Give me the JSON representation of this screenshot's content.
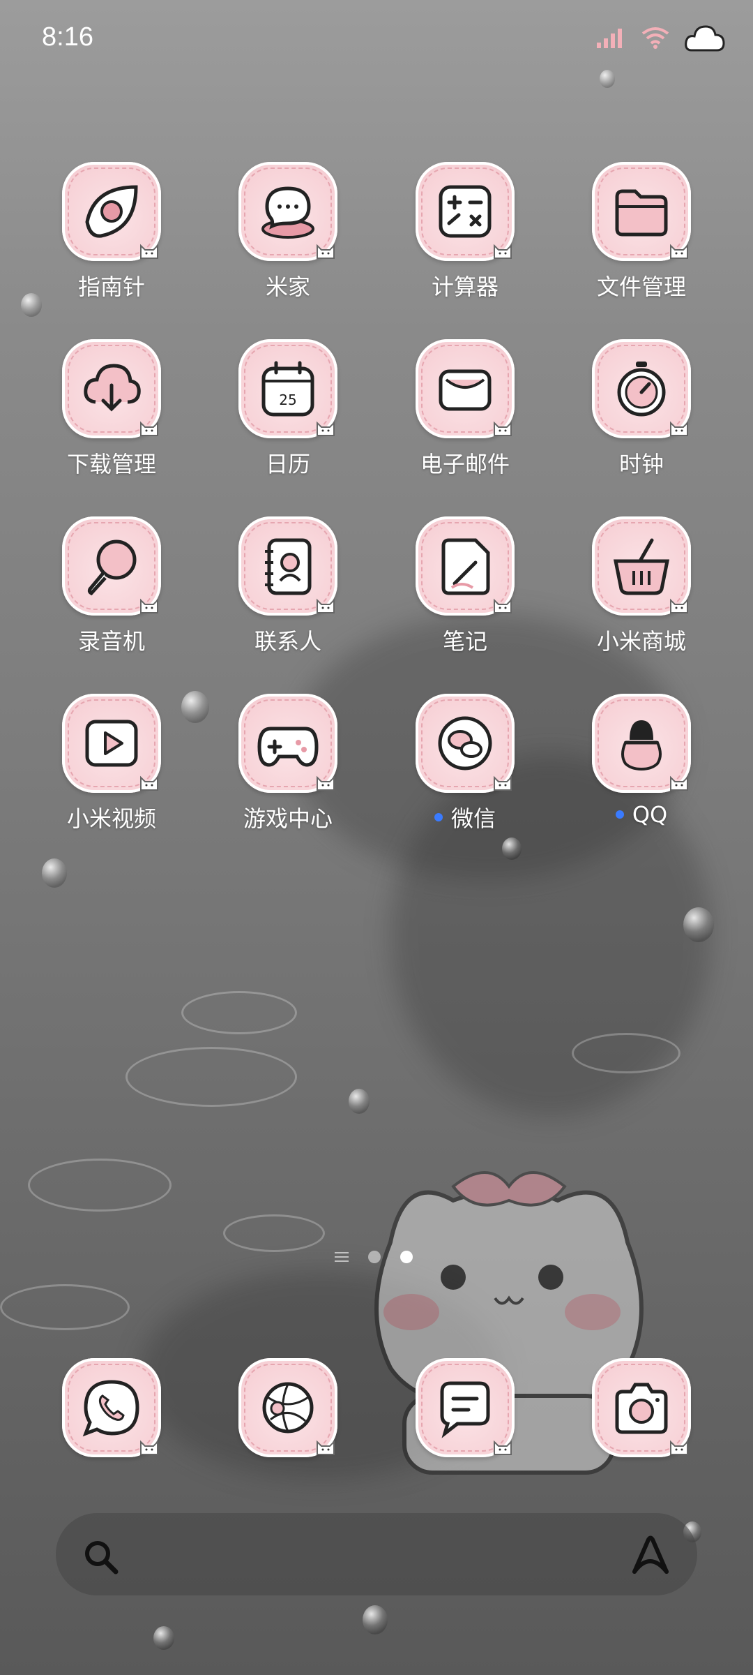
{
  "status_bar": {
    "time": "8:16"
  },
  "apps": [
    {
      "label": "指南针",
      "icon": "compass-icon"
    },
    {
      "label": "米家",
      "icon": "chat-bubble-icon"
    },
    {
      "label": "计算器",
      "icon": "calculator-icon"
    },
    {
      "label": "文件管理",
      "icon": "folder-icon"
    },
    {
      "label": "下载管理",
      "icon": "cloud-download-icon"
    },
    {
      "label": "日历",
      "icon": "calendar-icon",
      "date": "25"
    },
    {
      "label": "电子邮件",
      "icon": "envelope-icon"
    },
    {
      "label": "时钟",
      "icon": "stopwatch-icon"
    },
    {
      "label": "录音机",
      "icon": "microphone-icon"
    },
    {
      "label": "联系人",
      "icon": "contacts-book-icon"
    },
    {
      "label": "笔记",
      "icon": "notes-icon"
    },
    {
      "label": "小米商城",
      "icon": "shopping-basket-icon"
    },
    {
      "label": "小米视频",
      "icon": "play-icon"
    },
    {
      "label": "游戏中心",
      "icon": "gamepad-icon"
    },
    {
      "label": "微信",
      "icon": "wechat-icon",
      "new": true
    },
    {
      "label": "QQ",
      "icon": "qq-penguin-icon",
      "new": true
    }
  ],
  "dock": [
    {
      "icon": "phone-icon"
    },
    {
      "icon": "browser-icon"
    },
    {
      "icon": "message-icon"
    },
    {
      "icon": "camera-icon"
    }
  ],
  "page_indicator": {
    "pages": 2,
    "active": 2
  },
  "colors": {
    "tile": "#f7d2d7",
    "new_dot": "#3a7bff"
  }
}
